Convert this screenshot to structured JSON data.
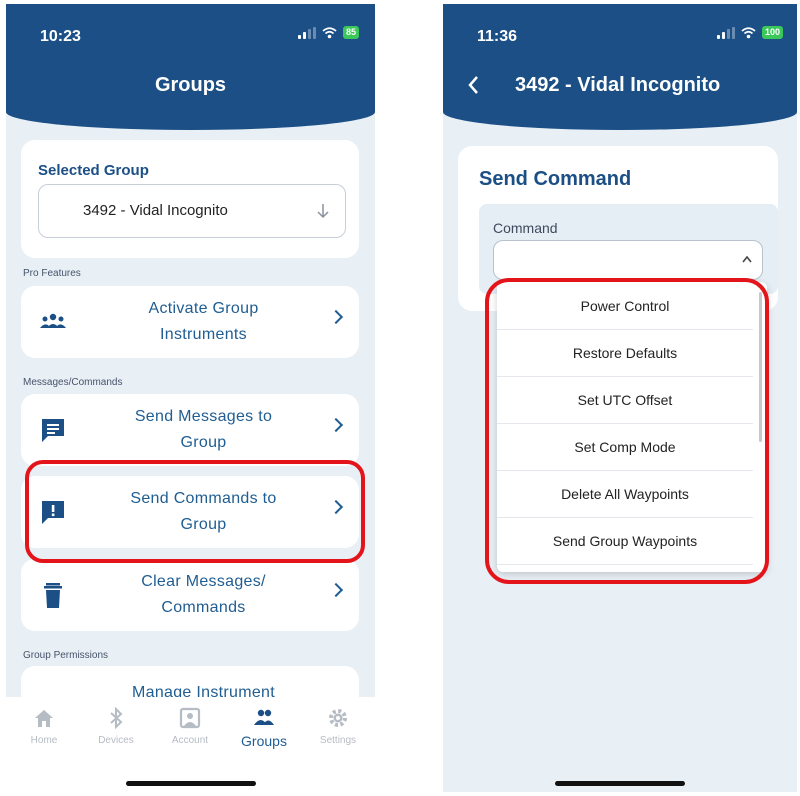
{
  "left": {
    "status": {
      "time": "10:23",
      "battery": "85"
    },
    "header": {
      "title": "Groups"
    },
    "selected_group": {
      "label": "Selected Group",
      "value": "3492 - Vidal Incognito"
    },
    "sections": {
      "pro": "Pro Features",
      "messages": "Messages/Commands",
      "permissions": "Group Permissions"
    },
    "rows": {
      "activate": {
        "line1": "Activate Group",
        "line2": "Instruments",
        "icon": "people-group-icon"
      },
      "send_messages": {
        "line1": "Send Messages to",
        "line2": "Group",
        "icon": "message-icon"
      },
      "send_commands": {
        "line1": "Send Commands to",
        "line2": "Group",
        "icon": "alert-message-icon"
      },
      "clear": {
        "line1": "Clear Messages/",
        "line2": "Commands",
        "icon": "trash-icon"
      },
      "manage": {
        "line1": "Manage Instrument",
        "icon": "umbrella-icon"
      }
    },
    "tabs": [
      {
        "label": "Home",
        "icon": "home-icon"
      },
      {
        "label": "Devices",
        "icon": "bluetooth-icon"
      },
      {
        "label": "Account",
        "icon": "account-icon"
      },
      {
        "label": "Groups",
        "icon": "groups-icon",
        "active": true
      },
      {
        "label": "Settings",
        "icon": "gear-icon"
      }
    ],
    "colors": {
      "header": "#1b4f86",
      "accent": "#1f5d92",
      "highlight": "#e4151a"
    }
  },
  "right": {
    "status": {
      "time": "11:36",
      "battery": "100"
    },
    "header": {
      "title": "3492 - Vidal Incognito"
    },
    "card_title": "Send Command",
    "command_label": "Command",
    "options": [
      "Power Control",
      "Restore Defaults",
      "Set UTC Offset",
      "Set Comp Mode",
      "Delete All Waypoints",
      "Send Group Waypoints"
    ]
  }
}
